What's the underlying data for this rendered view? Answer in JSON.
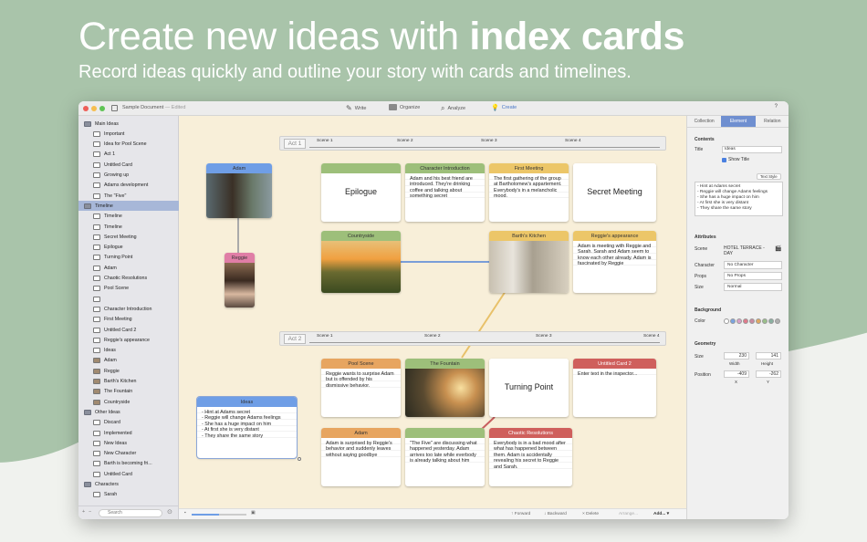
{
  "hero": {
    "title_light": "Create new ideas with ",
    "title_bold": "index cards",
    "subtitle": "Record ideas quickly and outline your story with cards and timelines."
  },
  "window": {
    "doc_title": "Sample Document",
    "doc_status": "— Edited",
    "toolbar": [
      "Write",
      "Organize",
      "Analyze",
      "Create"
    ],
    "help": "?"
  },
  "sidebar": {
    "items": [
      {
        "label": "Main Ideas",
        "icon": "folder-icon"
      },
      {
        "label": "Important",
        "icon": "text-card-icon"
      },
      {
        "label": "Idea for Pool Scene",
        "icon": "text-card-icon"
      },
      {
        "label": "Act 1",
        "icon": "text-card-icon"
      },
      {
        "label": "Untitled Card",
        "icon": "text-card-icon"
      },
      {
        "label": "Growing up",
        "icon": "text-card-icon"
      },
      {
        "label": "Adams development",
        "icon": "text-card-icon"
      },
      {
        "label": "The \"Five\"",
        "icon": "text-card-icon"
      },
      {
        "label": "Timeline",
        "icon": "folder-icon"
      },
      {
        "label": "Timeline",
        "icon": "timeline-icon"
      },
      {
        "label": "Timeline",
        "icon": "timeline-icon"
      },
      {
        "label": "Secret Meeting",
        "icon": "text-card-icon"
      },
      {
        "label": "Epilogue",
        "icon": "text-card-icon"
      },
      {
        "label": "Turning Point",
        "icon": "text-card-icon"
      },
      {
        "label": "Adam",
        "icon": "text-card-icon"
      },
      {
        "label": "Chaotic Resolutions",
        "icon": "text-card-icon"
      },
      {
        "label": "Pool Scene",
        "icon": "text-card-icon"
      },
      {
        "label": "",
        "icon": "text-card-icon"
      },
      {
        "label": "Character Introduction",
        "icon": "text-card-icon"
      },
      {
        "label": "First Meeting",
        "icon": "text-card-icon"
      },
      {
        "label": "Untitled Card 2",
        "icon": "text-card-icon"
      },
      {
        "label": "Reggie's appearance",
        "icon": "text-card-icon"
      },
      {
        "label": "Ideas",
        "icon": "text-card-icon"
      },
      {
        "label": "Adam",
        "icon": "photo-icon"
      },
      {
        "label": "Reggie",
        "icon": "photo-icon"
      },
      {
        "label": "Barth's Kitchen",
        "icon": "photo-icon"
      },
      {
        "label": "The Fountain",
        "icon": "photo-icon"
      },
      {
        "label": "Countryside",
        "icon": "photo-icon"
      },
      {
        "label": "Other Ideas",
        "icon": "folder-icon"
      },
      {
        "label": "Discard",
        "icon": "text-card-icon"
      },
      {
        "label": "Implemented",
        "icon": "text-card-icon"
      },
      {
        "label": "New Ideas",
        "icon": "text-card-icon"
      },
      {
        "label": "New Character",
        "icon": "text-card-icon"
      },
      {
        "label": "Barth is becoming fri...",
        "icon": "text-card-icon"
      },
      {
        "label": "Untitled Card",
        "icon": "text-card-icon"
      },
      {
        "label": "Characters",
        "icon": "folder-icon"
      },
      {
        "label": "Sarah",
        "icon": "text-card-icon"
      }
    ],
    "search_placeholder": "Search"
  },
  "acts": [
    {
      "label": "Act 1",
      "scenes": [
        "Scene 1",
        "Scene 2",
        "Scene 3",
        "Scene 4"
      ]
    },
    {
      "label": "Act 2",
      "scenes": [
        "Scene 1",
        "Scene 2",
        "Scene 3",
        "Scene 4"
      ]
    }
  ],
  "cards": {
    "adam_photo": "Adam",
    "reggie_photo": "Reggie",
    "epilogue": "Epilogue",
    "char_intro": {
      "title": "Character Introduction",
      "text": "Adam and his best friend are introduced. They're drinking coffee and talking about something secret"
    },
    "first_meeting": {
      "title": "First Meeting",
      "text": "The first gathering of the group at Bartholomew's appartement. Everybody's in a melancholic mood."
    },
    "secret_meeting": "Secret Meeting",
    "countryside": "Countryside",
    "barths_kitchen": "Barth's Kitchen",
    "reggies_appearance": {
      "title": "Reggie's appearance",
      "text": "Adam is meeting with Reggie and Sarah. Sarah and Adam seem to know each other already. Adam is fascinated by Reggie"
    },
    "pool_scene": {
      "title": "Pool Scene",
      "text": "Reggie wants to surprise Adam but is offended by his dismissive behavior."
    },
    "fountain": "The Fountain",
    "turning_point": "Turning Point",
    "untitled2": {
      "title": "Untitled Card 2",
      "text": "Enter text in the inspector..."
    },
    "adam": {
      "title": "Adam",
      "text": "Adam is surprised by Reggie's behavior and suddenly leaves without saying goodbye"
    },
    "the_five": {
      "text": "\"The Five\" are discussing what happened yesterday. Adam arrives too late while everbody is already talking about him"
    },
    "chaotic": {
      "title": "Chaotic Resolutions",
      "text": "Everybody is in a bad mood after what has happened between them. Adam is accidentally revealing his secret to Reggie and Sarah."
    },
    "ideas": {
      "title": "Ideas",
      "lines": [
        "- Hint at Adams secret",
        "- Reggie will change Adams feelings",
        "- She has a huge impact on him",
        "- At first she is very distant",
        "- They share the same story"
      ]
    }
  },
  "statusbar": {
    "forward": "↑ Forward",
    "backward": "↓ Backward",
    "delete": "× Delete",
    "arrange": "Arrange...",
    "add": "Add... ▾"
  },
  "inspector": {
    "tabs": [
      "Collection",
      "Element",
      "Relation"
    ],
    "contents_header": "Contents",
    "title_label": "Title",
    "title_value": "Ideas",
    "show_title": "Show Title",
    "text_style": "Text Style",
    "text_lines": [
      "- Hint at Adams secret",
      "- Reggie will change Adams feelings",
      "- She has a huge impact on him",
      "- At first she is very distant",
      "- They share the same story"
    ],
    "attributes_header": "Attributes",
    "scene_label": "Scene",
    "scene_value": "HOTEL TERRACE - DAY",
    "character_label": "Character",
    "character_value": "No Character",
    "props_label": "Props",
    "props_value": "No Props",
    "size_label": "Size",
    "size_value": "Normal",
    "background_header": "Background",
    "color_label": "Color",
    "colors": [
      "#ffffff",
      "#7aa3e0",
      "#d9a0c8",
      "#e07a8a",
      "#c98aa0",
      "#e0a860",
      "#9ac08a",
      "#8ab0a0",
      "#b0b0b0"
    ],
    "geometry_header": "Geometry",
    "size_geo_label": "Size",
    "width": "230",
    "height": "141",
    "width_label": "Width",
    "height_label": "Height",
    "position_label": "Position",
    "pos_x": "-409",
    "pos_y": "-262",
    "x_label": "X",
    "y_label": "Y"
  }
}
